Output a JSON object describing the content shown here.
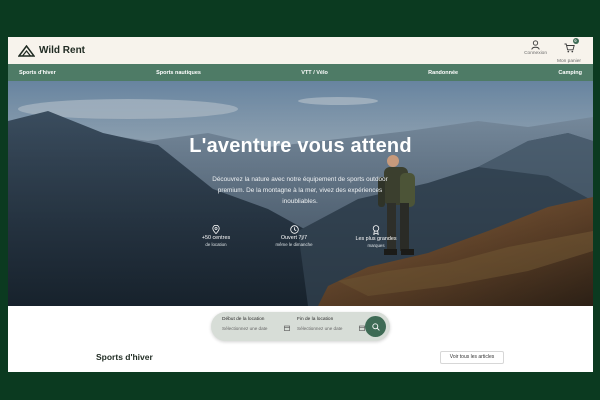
{
  "header": {
    "brand": "Wild Rent",
    "account_label": "Connexion",
    "cart_label": "Mon panier",
    "cart_count": "0"
  },
  "nav": {
    "items": [
      {
        "label": "Sports d'hiver"
      },
      {
        "label": "Sports nautiques"
      },
      {
        "label": "VTT / Vélo"
      },
      {
        "label": "Randonnée"
      },
      {
        "label": "Camping"
      }
    ]
  },
  "hero": {
    "title": "L'aventure vous attend",
    "subtitle": "Découvrez la nature avec notre équipement de sports outdoor premium. De la montagne à la mer, vivez des expériences inoubliables.",
    "features": [
      {
        "icon": "location-pin-icon",
        "label": "+50 centres",
        "sub": "de location"
      },
      {
        "icon": "clock-icon",
        "label": "Ouvert 7j/7",
        "sub": "même le dimanche"
      },
      {
        "icon": "award-icon",
        "label": "Les plus grandes",
        "sub": "marques"
      }
    ]
  },
  "search": {
    "start_label": "Début de la location",
    "start_placeholder": "Sélectionnez une date",
    "end_label": "Fin de la location",
    "end_placeholder": "Sélectionnez une date"
  },
  "section": {
    "title": "Sports d'hiver",
    "view_all": "Voir tous les articles"
  },
  "colors": {
    "background": "#0b3a20",
    "header": "#f7f3ec",
    "nav": "#4e7b66",
    "accent": "#3e6b55"
  }
}
